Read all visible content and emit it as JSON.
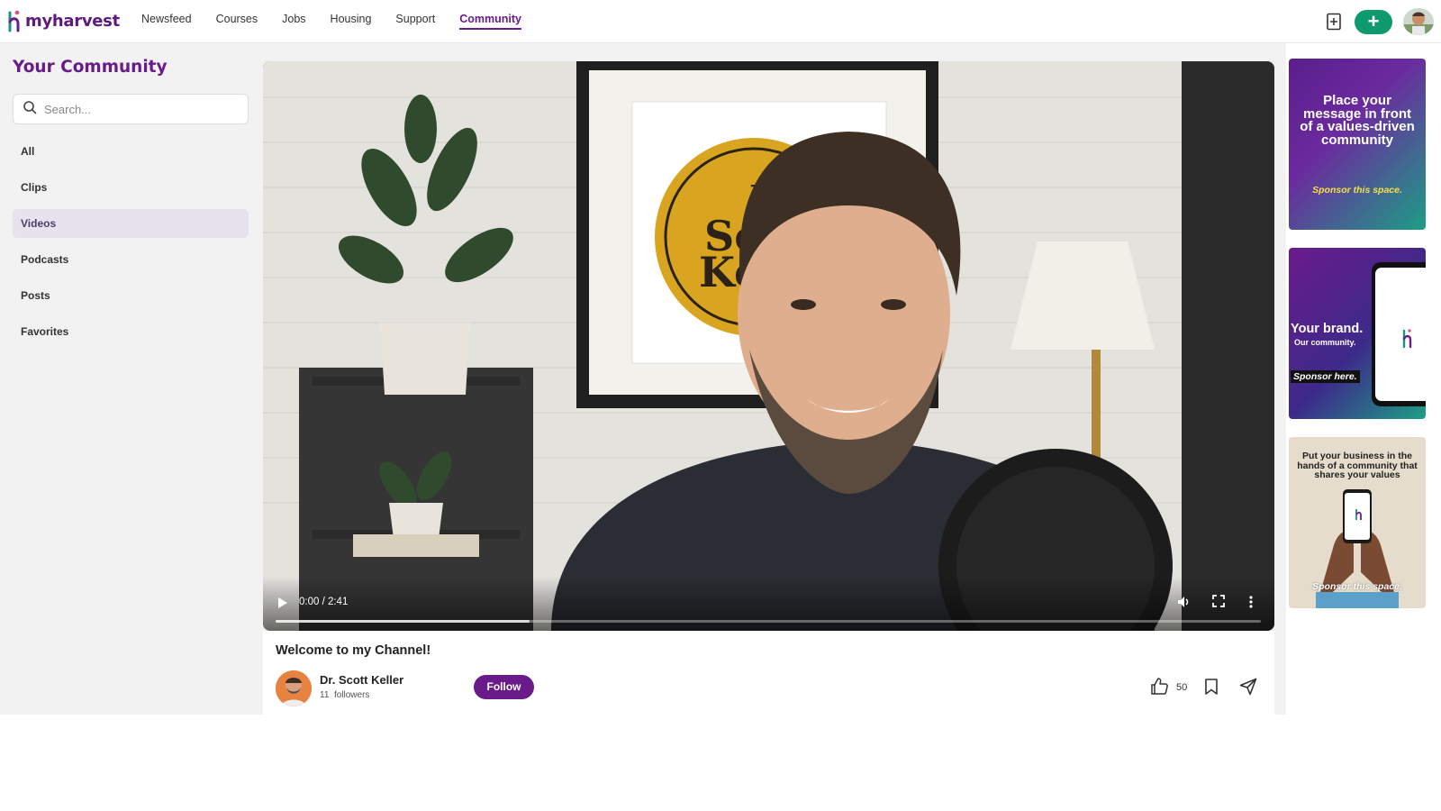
{
  "brand": {
    "name": "myharvest"
  },
  "nav": {
    "items": [
      {
        "label": "Newsfeed"
      },
      {
        "label": "Courses"
      },
      {
        "label": "Jobs"
      },
      {
        "label": "Housing"
      },
      {
        "label": "Support"
      },
      {
        "label": "Community",
        "active": true
      }
    ]
  },
  "header": {
    "add_button": "+"
  },
  "sidebar": {
    "title": "Your Community",
    "search_placeholder": "Search...",
    "items": [
      {
        "label": "All"
      },
      {
        "label": "Clips"
      },
      {
        "label": "Videos",
        "active": true
      },
      {
        "label": "Podcasts"
      },
      {
        "label": "Posts"
      },
      {
        "label": "Favorites"
      }
    ]
  },
  "video": {
    "time": "0:00 / 2:41",
    "progress_buffered": 0.258,
    "title": "Welcome to my Channel!",
    "author": "Dr. Scott Keller",
    "followers_count": "11",
    "followers_label": "followers",
    "follow_label": "Follow",
    "likes": "50"
  },
  "ads": {
    "ad1": {
      "text": "Place your message in front of a values-driven community",
      "cta": "Sponsor this space."
    },
    "ad2": {
      "title": "Your brand.",
      "subtitle": "Our community.",
      "cta": "Sponsor here."
    },
    "ad3": {
      "text": "Put your business in the hands of a community that shares your values",
      "cta": "Sponsor this space."
    }
  },
  "colors": {
    "brand_purple": "#6a1b8a",
    "brand_green": "#0f9a6e"
  }
}
